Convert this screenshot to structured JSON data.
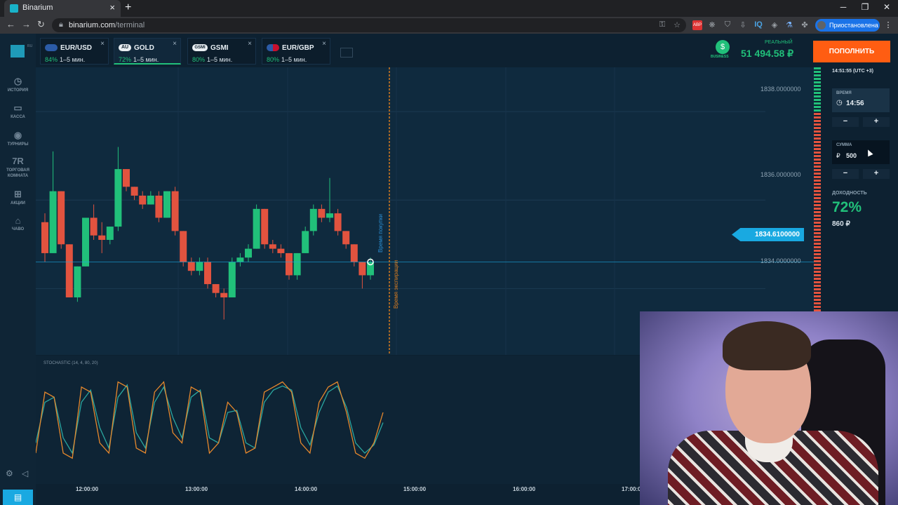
{
  "browser": {
    "tab_title": "Binarium",
    "url_host": "binarium.com",
    "url_path": "/terminal",
    "profile_label": "Приостановлена"
  },
  "sidebar": {
    "items": [
      {
        "label": "ИСТОРИЯ",
        "icon": "history-icon"
      },
      {
        "label": "КАССА",
        "icon": "wallet-icon"
      },
      {
        "label": "ТУРНИРЫ",
        "icon": "trophy-icon"
      },
      {
        "label": "ТОРГОВАЯ КОМНАТА",
        "icon": "trading-room-icon"
      },
      {
        "label": "АКЦИИ",
        "icon": "gift-icon"
      },
      {
        "label": "ЧАВО",
        "icon": "faq-icon"
      }
    ]
  },
  "logo_suffix": "RU",
  "assets": [
    {
      "name": "EUR/USD",
      "pct": "84%",
      "dur": "1–5 мин.",
      "badge": ""
    },
    {
      "name": "GOLD",
      "pct": "72%",
      "dur": "1–5 мин.",
      "badge": "AU"
    },
    {
      "name": "GSMI",
      "pct": "80%",
      "dur": "1–5 мин.",
      "badge": "GSMI"
    },
    {
      "name": "EUR/GBP",
      "pct": "80%",
      "dur": "1–5 мин.",
      "badge": ""
    }
  ],
  "account": {
    "type": "РЕАЛЬНЫЙ",
    "balance": "51 494.58 ₽",
    "business": "BUSINESS",
    "deposit_label": "ПОПОЛНИТЬ"
  },
  "chart": {
    "price_labels": [
      "1838.0000000",
      "1836.0000000",
      "1834.0000000"
    ],
    "current_price": "1834.6100000",
    "purchase_label": "Время покупки",
    "expiry_label": "Время экспирации",
    "indicator": "STOCHASTIC (14, 4, 80, 20)",
    "time_labels": [
      "12:00:00",
      "13:00:00",
      "14:00:00",
      "15:00:00",
      "16:00:00",
      "17:00:00"
    ]
  },
  "chart_data": {
    "type": "candlestick",
    "ylim": [
      1832.5,
      1839
    ],
    "candles": [
      [
        1835.5,
        1834.8,
        1835.7,
        1834.6
      ],
      [
        1834.8,
        1836.2,
        1837.1,
        1834.8
      ],
      [
        1836.2,
        1835.0,
        1836.2,
        1834.9
      ],
      [
        1835.0,
        1833.8,
        1835.0,
        1833.8
      ],
      [
        1833.8,
        1834.5,
        1834.5,
        1833.7
      ],
      [
        1834.5,
        1835.6,
        1835.6,
        1834.5
      ],
      [
        1835.6,
        1835.2,
        1835.9,
        1835.1
      ],
      [
        1835.2,
        1835.1,
        1835.5,
        1834.8
      ],
      [
        1835.1,
        1835.4,
        1835.4,
        1835.0
      ],
      [
        1835.4,
        1836.7,
        1837.2,
        1835.3
      ],
      [
        1836.7,
        1836.3,
        1836.7,
        1836.2
      ],
      [
        1836.3,
        1836.1,
        1836.3,
        1836.0
      ],
      [
        1836.1,
        1835.9,
        1836.2,
        1835.8
      ],
      [
        1835.9,
        1836.1,
        1836.2,
        1835.9
      ],
      [
        1836.1,
        1835.6,
        1836.2,
        1835.5
      ],
      [
        1835.6,
        1836.2,
        1836.2,
        1835.6
      ],
      [
        1836.2,
        1835.3,
        1836.3,
        1835.2
      ],
      [
        1835.3,
        1834.6,
        1835.3,
        1834.5
      ],
      [
        1834.6,
        1834.4,
        1834.7,
        1834.3
      ],
      [
        1834.4,
        1834.6,
        1834.7,
        1834.3
      ],
      [
        1834.6,
        1834.1,
        1834.7,
        1834.0
      ],
      [
        1834.1,
        1833.9,
        1834.1,
        1833.8
      ],
      [
        1833.9,
        1833.8,
        1834.0,
        1833.3
      ],
      [
        1833.8,
        1834.6,
        1834.7,
        1833.8
      ],
      [
        1834.6,
        1834.7,
        1834.8,
        1834.5
      ],
      [
        1834.7,
        1834.9,
        1835.0,
        1834.6
      ],
      [
        1834.9,
        1835.8,
        1835.9,
        1834.9
      ],
      [
        1835.8,
        1835.0,
        1835.8,
        1834.9
      ],
      [
        1835.0,
        1834.9,
        1835.1,
        1834.8
      ],
      [
        1834.9,
        1834.8,
        1835.0,
        1834.7
      ],
      [
        1834.8,
        1834.3,
        1834.8,
        1834.2
      ],
      [
        1834.3,
        1834.8,
        1834.8,
        1834.2
      ],
      [
        1834.8,
        1835.3,
        1835.4,
        1834.8
      ],
      [
        1835.3,
        1835.8,
        1835.9,
        1835.2
      ],
      [
        1835.8,
        1835.6,
        1835.9,
        1835.5
      ],
      [
        1835.6,
        1835.7,
        1836.5,
        1835.5
      ],
      [
        1835.7,
        1835.3,
        1835.8,
        1835.2
      ],
      [
        1835.3,
        1835.0,
        1835.3,
        1834.9
      ],
      [
        1835.0,
        1834.6,
        1835.0,
        1834.5
      ],
      [
        1834.6,
        1834.3,
        1834.6,
        1834.0
      ],
      [
        1834.3,
        1834.6,
        1834.7,
        1834.2
      ]
    ]
  },
  "stochastic_data": {
    "k": [
      20,
      80,
      75,
      20,
      15,
      85,
      80,
      30,
      20,
      90,
      85,
      25,
      20,
      80,
      90,
      40,
      30,
      85,
      80,
      20,
      30,
      70,
      60,
      20,
      25,
      80,
      85,
      90,
      80,
      30,
      20,
      70,
      85,
      90,
      60,
      20,
      15,
      30,
      60
    ],
    "d": [
      30,
      70,
      75,
      35,
      20,
      70,
      82,
      45,
      25,
      75,
      87,
      40,
      25,
      70,
      85,
      55,
      35,
      75,
      82,
      35,
      30,
      60,
      62,
      30,
      25,
      70,
      82,
      86,
      82,
      45,
      28,
      60,
      80,
      86,
      65,
      30,
      20,
      28,
      50
    ]
  },
  "panel": {
    "clock": "14:51:55 (UTC +3)",
    "time_label": "ВРЕМЯ",
    "time_value": "14:56",
    "sum_label": "СУММА",
    "sum_currency": "₽",
    "sum_value": "500",
    "yield_label": "ДОХОДНОСТЬ",
    "yield_pct": "72%",
    "yield_amount": "860 ₽",
    "minus": "−",
    "plus": "+"
  },
  "colors": {
    "up": "#21c07a",
    "down": "#e2533f",
    "accent": "#ff5d12",
    "price_line": "#19a9e1"
  }
}
